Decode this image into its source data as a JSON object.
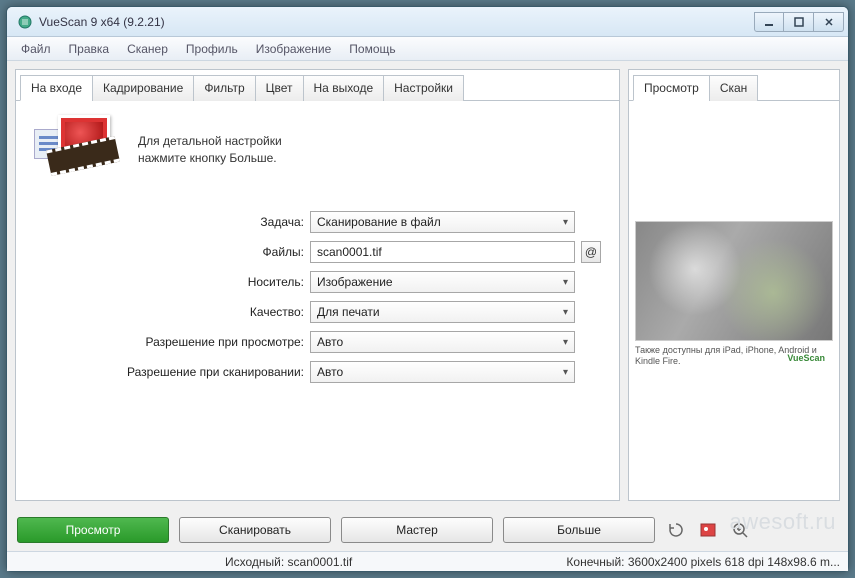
{
  "window": {
    "title": "VueScan 9 x64 (9.2.21)"
  },
  "menu": {
    "items": [
      "Файл",
      "Правка",
      "Сканер",
      "Профиль",
      "Изображение",
      "Помощь"
    ]
  },
  "left_tabs": {
    "items": [
      "На входе",
      "Кадрирование",
      "Фильтр",
      "Цвет",
      "На выходе",
      "Настройки"
    ],
    "active": 0
  },
  "right_tabs": {
    "items": [
      "Просмотр",
      "Скан"
    ],
    "active": 0
  },
  "intro": {
    "line1": "Для детальной настройки",
    "line2": "нажмите кнопку Больше."
  },
  "fields": {
    "task": {
      "label": "Задача:",
      "value": "Сканирование в файл"
    },
    "files": {
      "label": "Файлы:",
      "value": "scan0001.tif",
      "at": "@"
    },
    "media": {
      "label": "Носитель:",
      "value": "Изображение"
    },
    "quality": {
      "label": "Качество:",
      "value": "Для печати"
    },
    "res_preview": {
      "label": "Разрешение при просмотре:",
      "value": "Авто"
    },
    "res_scan": {
      "label": "Разрешение при сканировании:",
      "value": "Авто"
    }
  },
  "buttons": {
    "preview": "Просмотр",
    "scan": "Сканировать",
    "wizard": "Мастер",
    "more": "Больше"
  },
  "preview": {
    "caption": "Также доступны для iPad, iPhone, Android и Kindle Fire.",
    "brand": "VueScan"
  },
  "status": {
    "source": "Исходный: scan0001.tif",
    "dest": "Конечный: 3600x2400 pixels 618 dpi 148x98.6 m..."
  },
  "watermark": "awesoft.ru"
}
